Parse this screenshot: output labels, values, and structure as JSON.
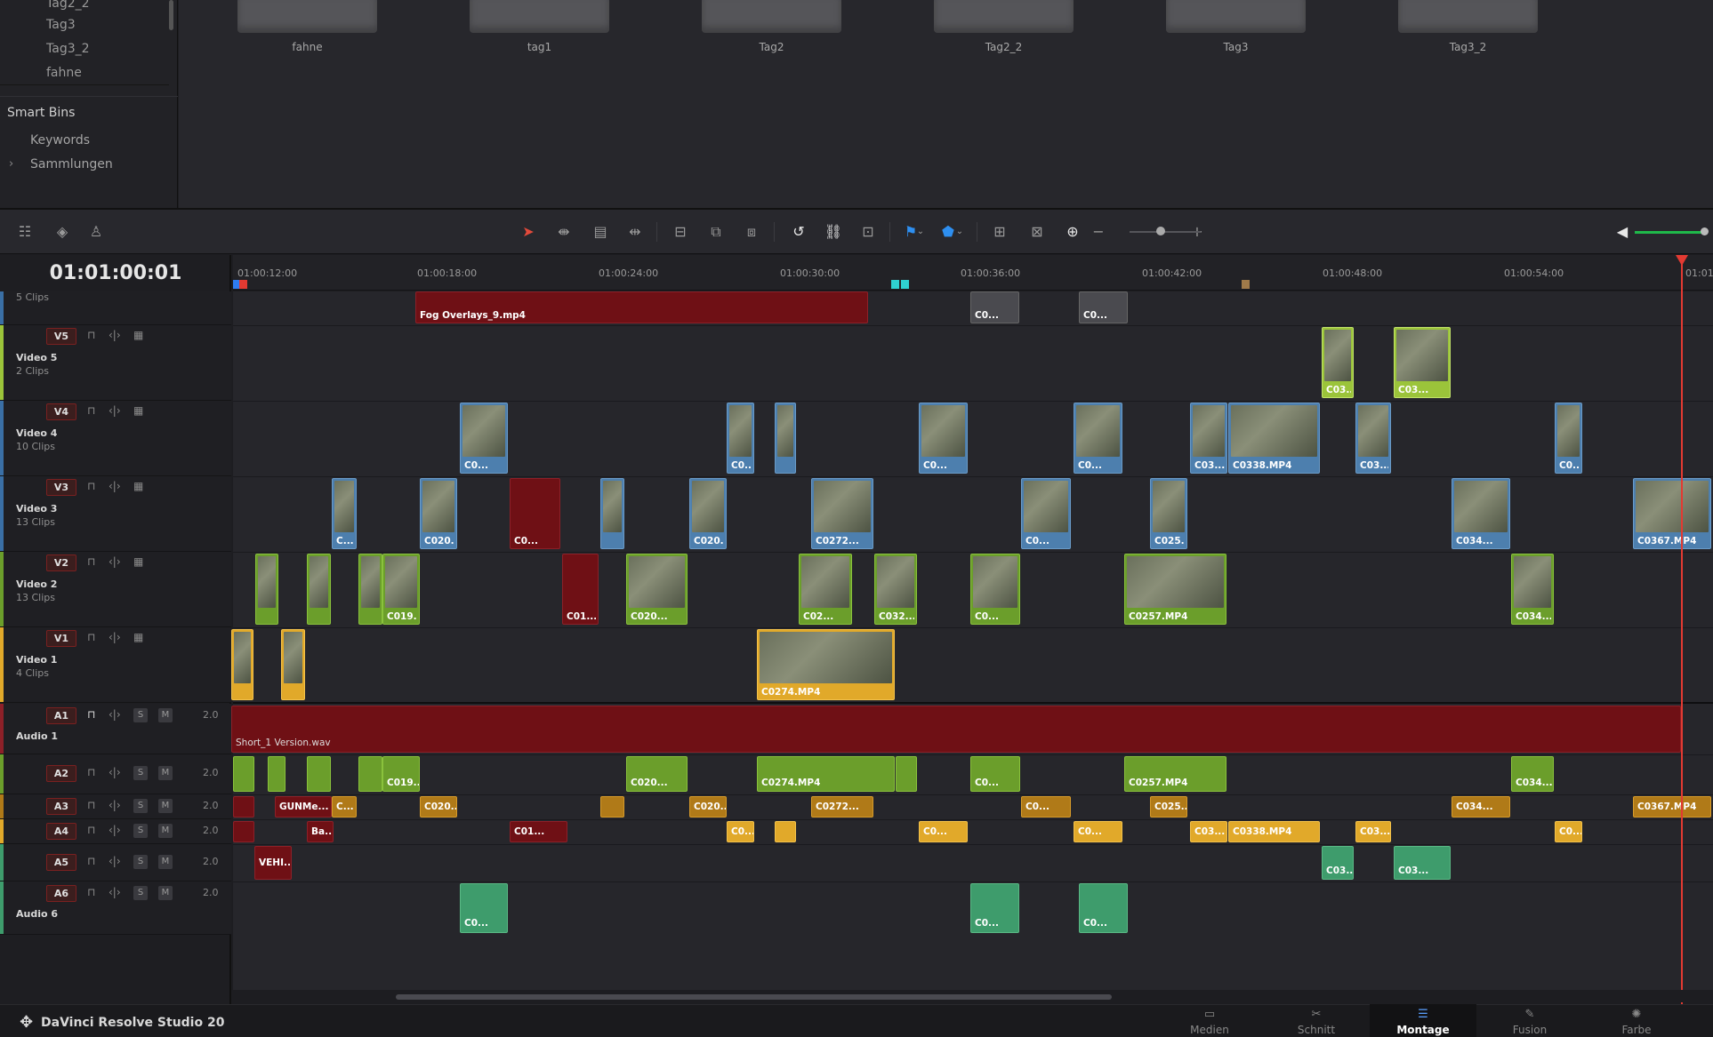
{
  "sidebar": {
    "bins": [
      "Tag2_2",
      "Tag3",
      "Tag3_2",
      "fahne"
    ],
    "smart_bins_label": "Smart Bins",
    "keywords_label": "Keywords",
    "collections_label": "Sammlungen"
  },
  "media_pool": {
    "items": [
      "fahne",
      "tag1",
      "Tag2",
      "Tag2_2",
      "Tag3",
      "Tag3_2"
    ]
  },
  "timeline": {
    "timecode": "01:01:00:01",
    "ruler": [
      "01:00:12:00",
      "01:00:18:00",
      "01:00:24:00",
      "01:00:30:00",
      "01:00:36:00",
      "01:00:42:00",
      "01:00:48:00",
      "01:00:54:00",
      "01:01:"
    ],
    "tracks": {
      "v6": {
        "count": "5 Clips"
      },
      "v5": {
        "badge": "V5",
        "name": "Video 5",
        "count": "2 Clips"
      },
      "v4": {
        "badge": "V4",
        "name": "Video 4",
        "count": "10 Clips"
      },
      "v3": {
        "badge": "V3",
        "name": "Video 3",
        "count": "13 Clips"
      },
      "v2": {
        "badge": "V2",
        "name": "Video 2",
        "count": "13 Clips"
      },
      "v1": {
        "badge": "V1",
        "name": "Video 1",
        "count": "4 Clips"
      },
      "a1": {
        "badge": "A1",
        "name": "Audio 1",
        "chan": "2.0"
      },
      "a2": {
        "badge": "A2",
        "chan": "2.0"
      },
      "a3": {
        "badge": "A3",
        "chan": "2.0"
      },
      "a4": {
        "badge": "A4",
        "chan": "2.0"
      },
      "a5": {
        "badge": "A5",
        "chan": "2.0"
      },
      "a6": {
        "badge": "A6",
        "name": "Audio 6",
        "chan": "2.0"
      }
    },
    "buttons": {
      "solo": "S",
      "mute": "M"
    },
    "clips": {
      "fog": "Fog Overlays_9.mp4",
      "v6a": "C0...",
      "v6b": "C0...",
      "v5a": "C03...",
      "v5b": "C03...",
      "v4a": "C0...",
      "v4b": "C0...",
      "v4c": "C0...",
      "v4d": "C0...",
      "v4e": "C03...",
      "v4f": "C0338.MP4",
      "v4g": "C03...",
      "v4h": "C0...",
      "v3a": "C...",
      "v3b": "C020...",
      "v3c": "C0...",
      "v3d": "C020...",
      "v3e": "C0272...",
      "v3f": "C0...",
      "v3g": "C025...",
      "v3h": "C034...",
      "v3i": "C0367.MP4",
      "v2a": "C019...",
      "v2b": "C01...",
      "v2c": "C020...",
      "v2d": "C02...",
      "v2e": "C032...",
      "v2f": "C0...",
      "v2g": "C0257.MP4",
      "v2h": "C034...",
      "v1a": "C0274.MP4",
      "a1": "Short_1 Version.wav",
      "a2a": "C019...",
      "a2b": "C020...",
      "a2c": "C0274.MP4",
      "a2d": "C0...",
      "a2e": "C0257.MP4",
      "a2f": "C034...",
      "a3a": "GUNMe...",
      "a3b": "C...",
      "a3c": "C020...",
      "a3d": "C020...",
      "a3e": "C0272...",
      "a3f": "C0...",
      "a3g": "C025...",
      "a3h": "C034...",
      "a3i": "C0367.MP4",
      "a4a": "Ba...",
      "a4b": "C01...",
      "a4c": "C0...",
      "a4d": "C0...",
      "a4e": "C0...",
      "a4f": "C03...",
      "a4g": "C0338.MP4",
      "a4h": "C03...",
      "a4i": "C0...",
      "a5a": "VEHI...",
      "a5b": "C03...",
      "a5c": "C03...",
      "a6a": "C0...",
      "a6b": "C0...",
      "a6c": "C0..."
    }
  },
  "bottom": {
    "brand": "DaVinci Resolve Studio 20",
    "pages": [
      "Medien",
      "Schnitt",
      "Montage",
      "Fusion",
      "Farbe"
    ],
    "active_page": "Montage"
  },
  "colors": {
    "playhead": "#e33a32",
    "video1": "#e1a92a",
    "video2": "#6b9e2b",
    "video3": "#4d7fae",
    "audio1": "#6f1015"
  }
}
